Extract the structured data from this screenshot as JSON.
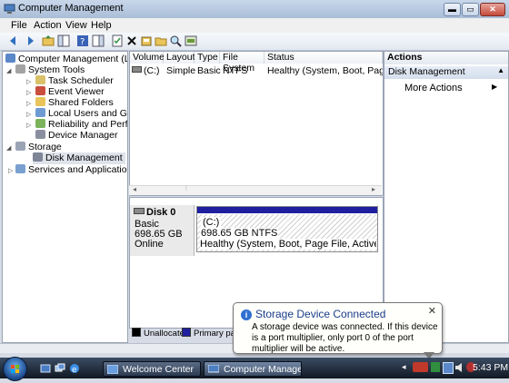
{
  "window": {
    "title": "Computer Management",
    "min_label": "▬",
    "max_label": "▭",
    "close_label": "✕"
  },
  "menu": [
    "File",
    "Action",
    "View",
    "Help"
  ],
  "tree": [
    {
      "label": "Computer Management (Local",
      "level": 0
    },
    {
      "label": "System Tools",
      "level": 1
    },
    {
      "label": "Task Scheduler",
      "level": 2
    },
    {
      "label": "Event Viewer",
      "level": 2
    },
    {
      "label": "Shared Folders",
      "level": 2
    },
    {
      "label": "Local Users and Groups",
      "level": 2
    },
    {
      "label": "Reliability and Performa",
      "level": 2
    },
    {
      "label": "Device Manager",
      "level": 2
    },
    {
      "label": "Storage",
      "level": 1
    },
    {
      "label": "Disk Management",
      "level": 2
    },
    {
      "label": "Services and Applications",
      "level": 1
    }
  ],
  "volumes": {
    "columns": [
      "Volume",
      "Layout",
      "Type",
      "File System",
      "Status"
    ],
    "rows": [
      [
        "(C:)",
        "Simple",
        "Basic",
        "NTFS",
        "Healthy (System, Boot, Page File,"
      ]
    ]
  },
  "disk": {
    "name": "Disk 0",
    "type": "Basic",
    "size": "698.65 GB",
    "state": "Online",
    "partition_label": "(C:)",
    "partition_size": "698.65 GB NTFS",
    "partition_status": "Healthy (System, Boot, Page File, Active, Crash Dum"
  },
  "legend": [
    {
      "label": "Unallocated",
      "color": "#000000"
    },
    {
      "label": "Primary partit",
      "color": "#1f1fa0"
    }
  ],
  "actions": {
    "header": "Actions",
    "section": "Disk Management",
    "more": "More Actions"
  },
  "balloon": {
    "title": "Storage Device Connected",
    "text": "A storage device was connected. If this device is a port multiplier, only port 0 of the port multiplier will be active."
  },
  "taskbar": {
    "tasks": [
      "Welcome Center",
      "Computer Manage..."
    ],
    "clock": "5:43 PM"
  }
}
